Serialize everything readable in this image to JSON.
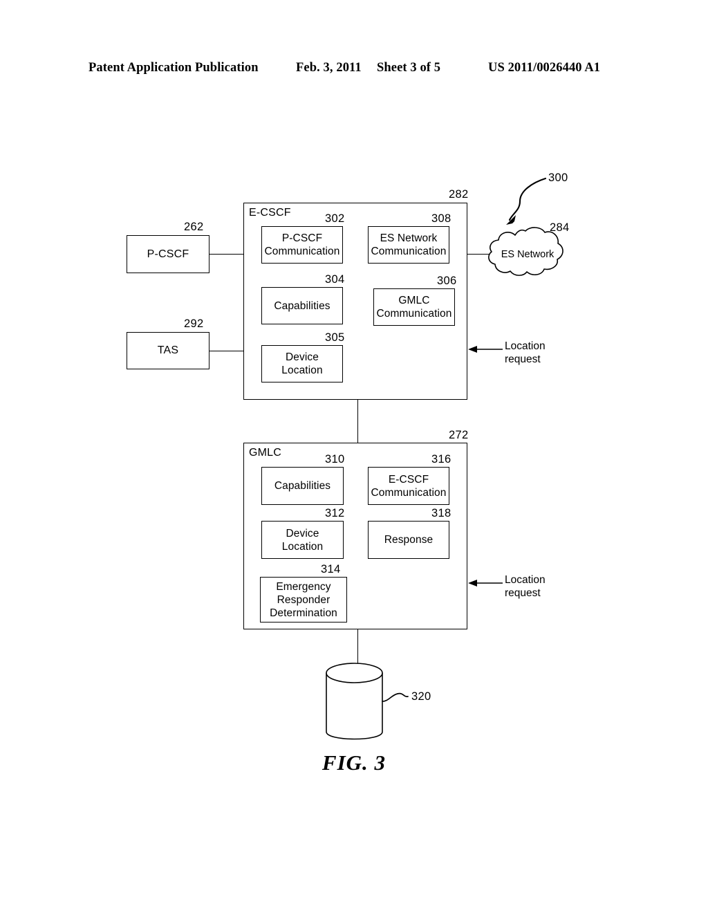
{
  "header": {
    "publication": "Patent Application Publication",
    "date": "Feb. 3, 2011",
    "sheet": "Sheet 3 of 5",
    "patent_number": "US 2011/0026440 A1"
  },
  "figure": {
    "caption": "FIG. 3",
    "overall_ref": "300"
  },
  "external_nodes": [
    {
      "label": "P-CSCF",
      "ref": "262"
    },
    {
      "label": "TAS",
      "ref": "292"
    }
  ],
  "cloud": {
    "label": "ES Network",
    "ref": "284"
  },
  "database": {
    "ref": "320"
  },
  "ecscf": {
    "title": "E-CSCF",
    "ref": "282",
    "modules": [
      {
        "label": "P-CSCF\nCommunication",
        "ref": "302"
      },
      {
        "label": "ES Network\nCommunication",
        "ref": "308"
      },
      {
        "label": "Capabilities",
        "ref": "304"
      },
      {
        "label": "GMLC\nCommunication",
        "ref": "306"
      },
      {
        "label": "Device\nLocation",
        "ref": "305"
      }
    ],
    "location_request": "Location\nrequest"
  },
  "gmlc": {
    "title": "GMLC",
    "ref": "272",
    "modules": [
      {
        "label": "Capabilities",
        "ref": "310"
      },
      {
        "label": "E-CSCF\nCommunication",
        "ref": "316"
      },
      {
        "label": "Device\nLocation",
        "ref": "312"
      },
      {
        "label": "Response",
        "ref": "318"
      },
      {
        "label": "Emergency\nResponder\nDetermination",
        "ref": "314"
      }
    ],
    "location_request": "Location\nrequest"
  },
  "colors": {
    "ink": "#000000",
    "paper": "#ffffff"
  }
}
